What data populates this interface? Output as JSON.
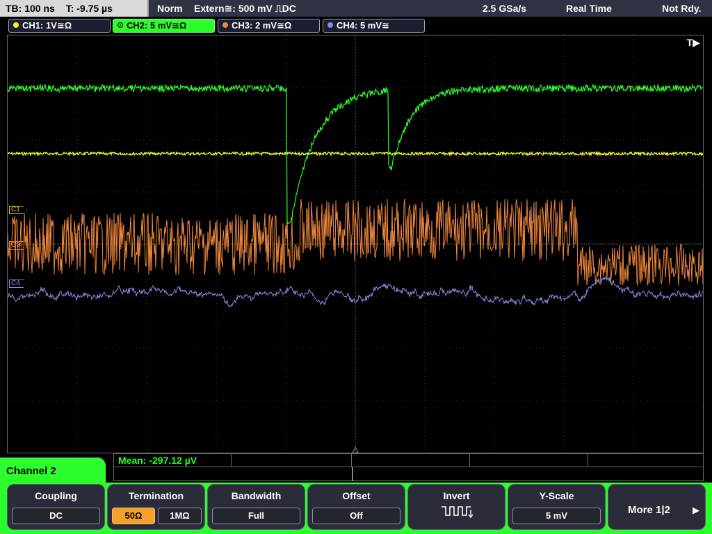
{
  "status": {
    "timebase": "TB: 100 ns",
    "trigger_time": "T: -9.75 µs",
    "mode": "Norm",
    "trigger_source": "Extern≅: 500 mV ⎍DC",
    "sample_rate": "2.5 GSa/s",
    "acq_mode": "Real Time",
    "state": "Not Rdy."
  },
  "channels": [
    {
      "label": "CH1: 1V≅Ω",
      "color": "#f5f52a"
    },
    {
      "label": "CH2: 5 mV≅Ω",
      "color": "#2dfc2d"
    },
    {
      "label": "CH3: 2 mV≅Ω",
      "color": "#f0883a"
    },
    {
      "label": "CH4: 5 mV≅",
      "color": "#8a8ae6"
    }
  ],
  "markers": {
    "c1": "C1",
    "c3": "C3",
    "c4": "C4",
    "trigger": "T▶"
  },
  "measurement": {
    "mean": "Mean: -297.12 µV"
  },
  "menu": {
    "title": "Channel 2",
    "coupling": {
      "title": "Coupling",
      "value": "DC"
    },
    "termination": {
      "title": "Termination",
      "opt1": "50Ω",
      "opt2": "1MΩ",
      "selected": "50Ω"
    },
    "bandwidth": {
      "title": "Bandwidth",
      "value": "Full"
    },
    "offset": {
      "title": "Offset",
      "value": "Off"
    },
    "invert": {
      "title": "Invert",
      "icon": "inverted-square-wave-icon"
    },
    "yscale": {
      "title": "Y-Scale",
      "value": "5 mV"
    },
    "more": {
      "label": "More 1|2",
      "icon": "arrow-right-icon"
    }
  }
}
